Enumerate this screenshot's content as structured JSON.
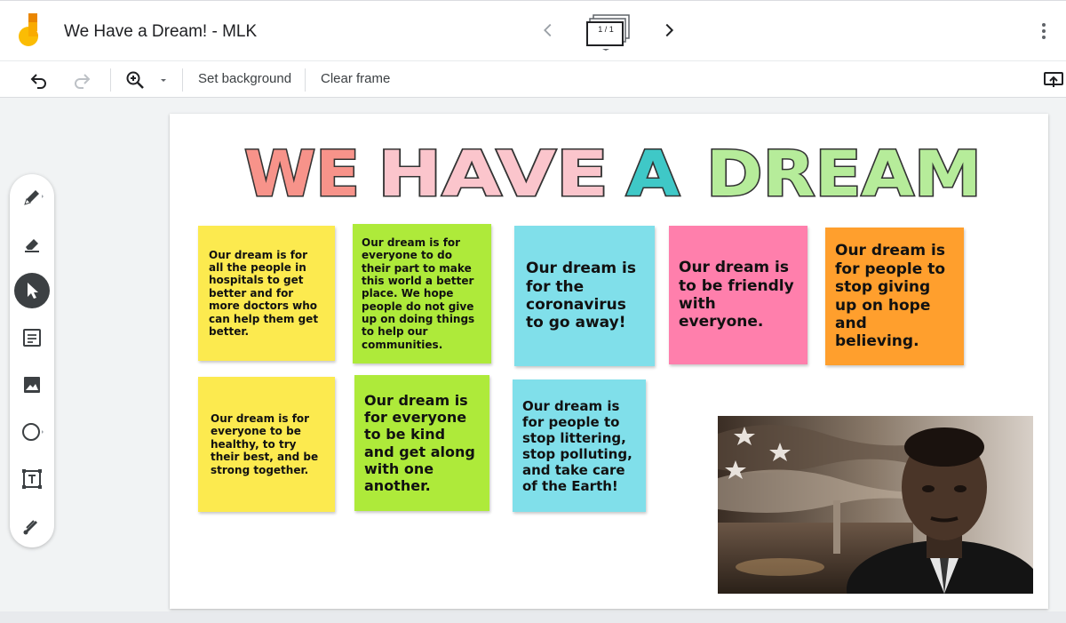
{
  "app": {
    "doc_title": "We Have a Dream! - MLK",
    "frame_counter": "1 / 1"
  },
  "toolbar": {
    "set_background_label": "Set background",
    "clear_frame_label": "Clear frame"
  },
  "colors": {
    "yellow_note": "#fcea4f",
    "green_note": "#aeea3a",
    "blue_note": "#80dfea",
    "pink_note": "#ff7fac",
    "orange_note": "#ff9f2d",
    "tool_active": "#3c4043"
  },
  "board": {
    "banner_text": "WE HAVE A DREAM",
    "notes": [
      {
        "text": "Our dream is for all the people in hospitals to get better and for more doctors who can help them get better.",
        "color": "yellow"
      },
      {
        "text": "Our dream is for everyone to do their part to make this world a better place. We hope people do not give up on doing things to help our communities.",
        "color": "green"
      },
      {
        "text": "Our dream is for the coronavirus to go away!",
        "color": "blue"
      },
      {
        "text": "Our dream is to be friendly with everyone.",
        "color": "pink"
      },
      {
        "text": "Our dream is for people to stop giving up on hope and believing.",
        "color": "orange"
      },
      {
        "text": "Our dream is for everyone to be healthy, to try their best, and be strong together.",
        "color": "yellow"
      },
      {
        "text": "Our dream is for everyone to be kind and get along with one another.",
        "color": "green"
      },
      {
        "text": "Our dream is for people to stop littering, stop polluting, and take care of the Earth!",
        "color": "blue"
      }
    ]
  },
  "tools": [
    "pen-icon",
    "eraser-icon",
    "select-icon",
    "sticky-note-icon",
    "image-icon",
    "circle-icon",
    "text-box-icon",
    "laser-icon"
  ]
}
